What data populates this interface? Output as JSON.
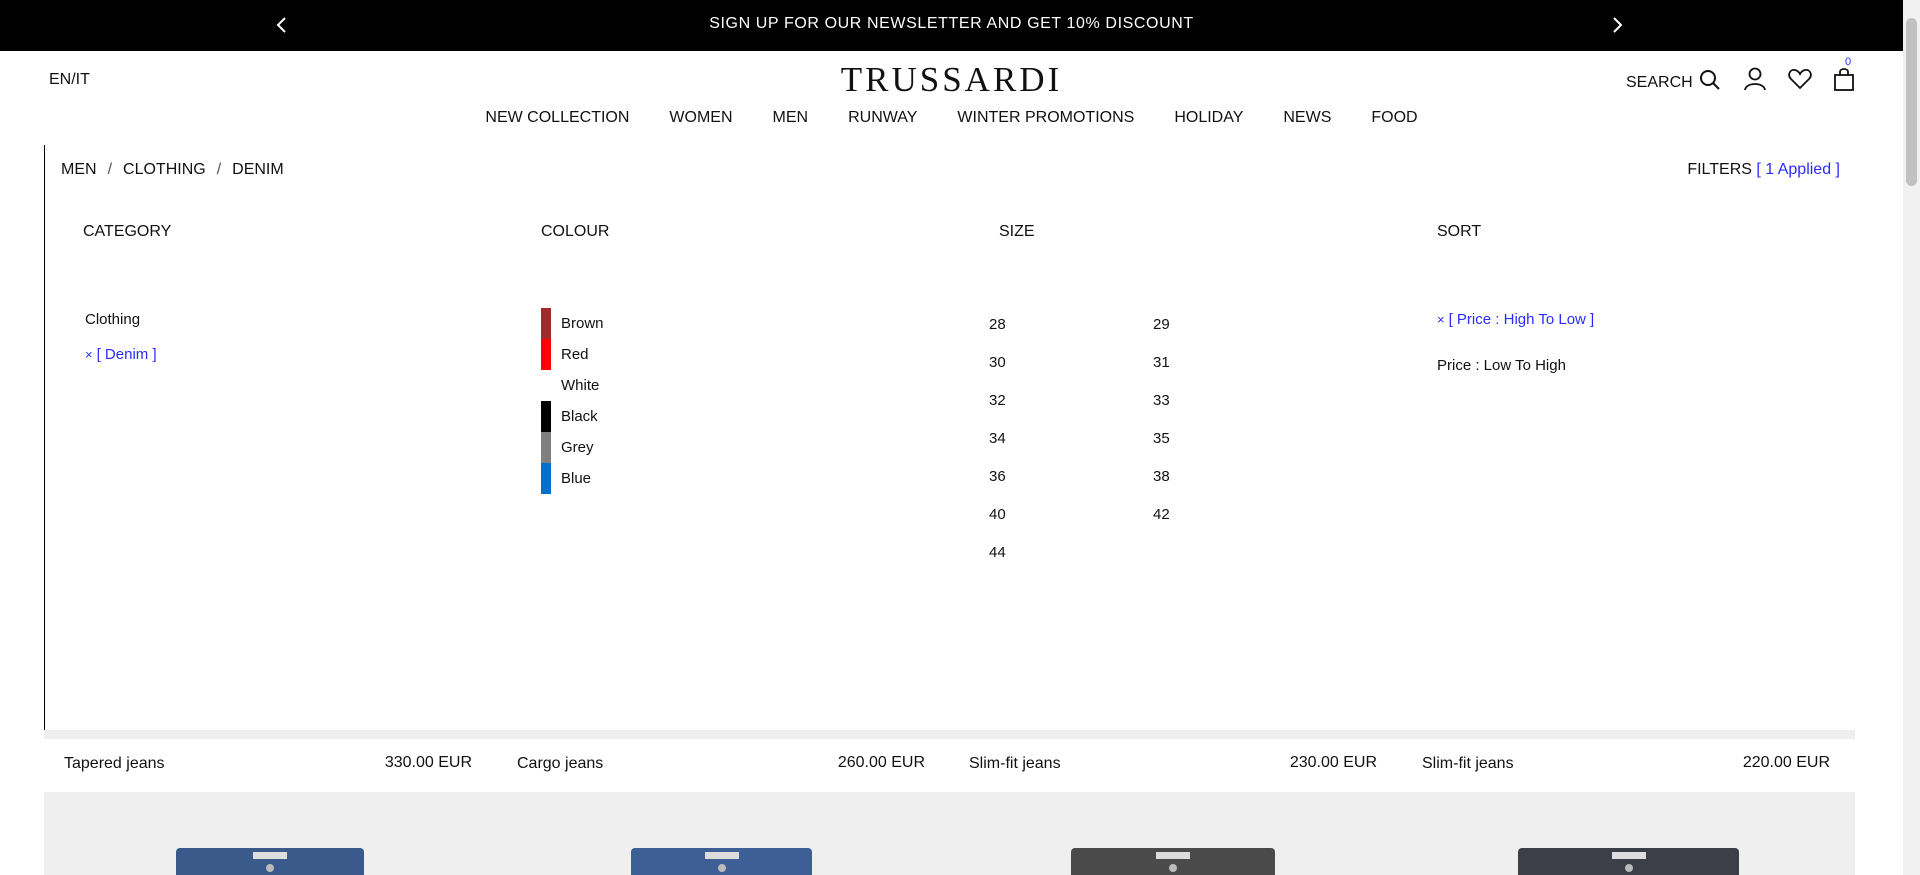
{
  "promo": {
    "message": "SIGN UP FOR OUR NEWSLETTER AND GET 10% DISCOUNT"
  },
  "header": {
    "lang": "EN/IT",
    "logo": "TRUSSARDI",
    "search_label": "SEARCH",
    "cart_count": "0"
  },
  "nav": [
    "NEW COLLECTION",
    "WOMEN",
    "MEN",
    "RUNWAY",
    "WINTER PROMOTIONS",
    "HOLIDAY",
    "NEWS",
    "FOOD"
  ],
  "breadcrumb": [
    "MEN",
    "CLOTHING",
    "DENIM"
  ],
  "filters": {
    "label": "FILTERS",
    "applied": "[ 1 Applied ]"
  },
  "category": {
    "title": "CATEGORY",
    "items": [
      "Clothing"
    ],
    "selected": "[ Denim ]"
  },
  "colour": {
    "title": "COLOUR",
    "items": [
      {
        "label": "Brown",
        "color": "#a32a2a"
      },
      {
        "label": "Red",
        "color": "#ff0000"
      },
      {
        "label": "White",
        "color": "#ffffff"
      },
      {
        "label": "Black",
        "color": "#000000"
      },
      {
        "label": "Grey",
        "color": "#808080"
      },
      {
        "label": "Blue",
        "color": "#0070d0"
      }
    ]
  },
  "size": {
    "title": "SIZE",
    "items": [
      "28",
      "29",
      "30",
      "31",
      "32",
      "33",
      "34",
      "35",
      "36",
      "38",
      "40",
      "42",
      "44"
    ]
  },
  "sort": {
    "title": "SORT",
    "selected": "[ Price : High To Low ]",
    "other": "Price : Low To High"
  },
  "products": [
    {
      "name": "Tapered jeans",
      "price": "330.00 EUR"
    },
    {
      "name": "Cargo jeans",
      "price": "260.00 EUR"
    },
    {
      "name": "Slim-fit jeans",
      "price": "230.00 EUR"
    },
    {
      "name": "Slim-fit jeans",
      "price": "220.00 EUR"
    }
  ],
  "icons": {
    "close": "×"
  }
}
